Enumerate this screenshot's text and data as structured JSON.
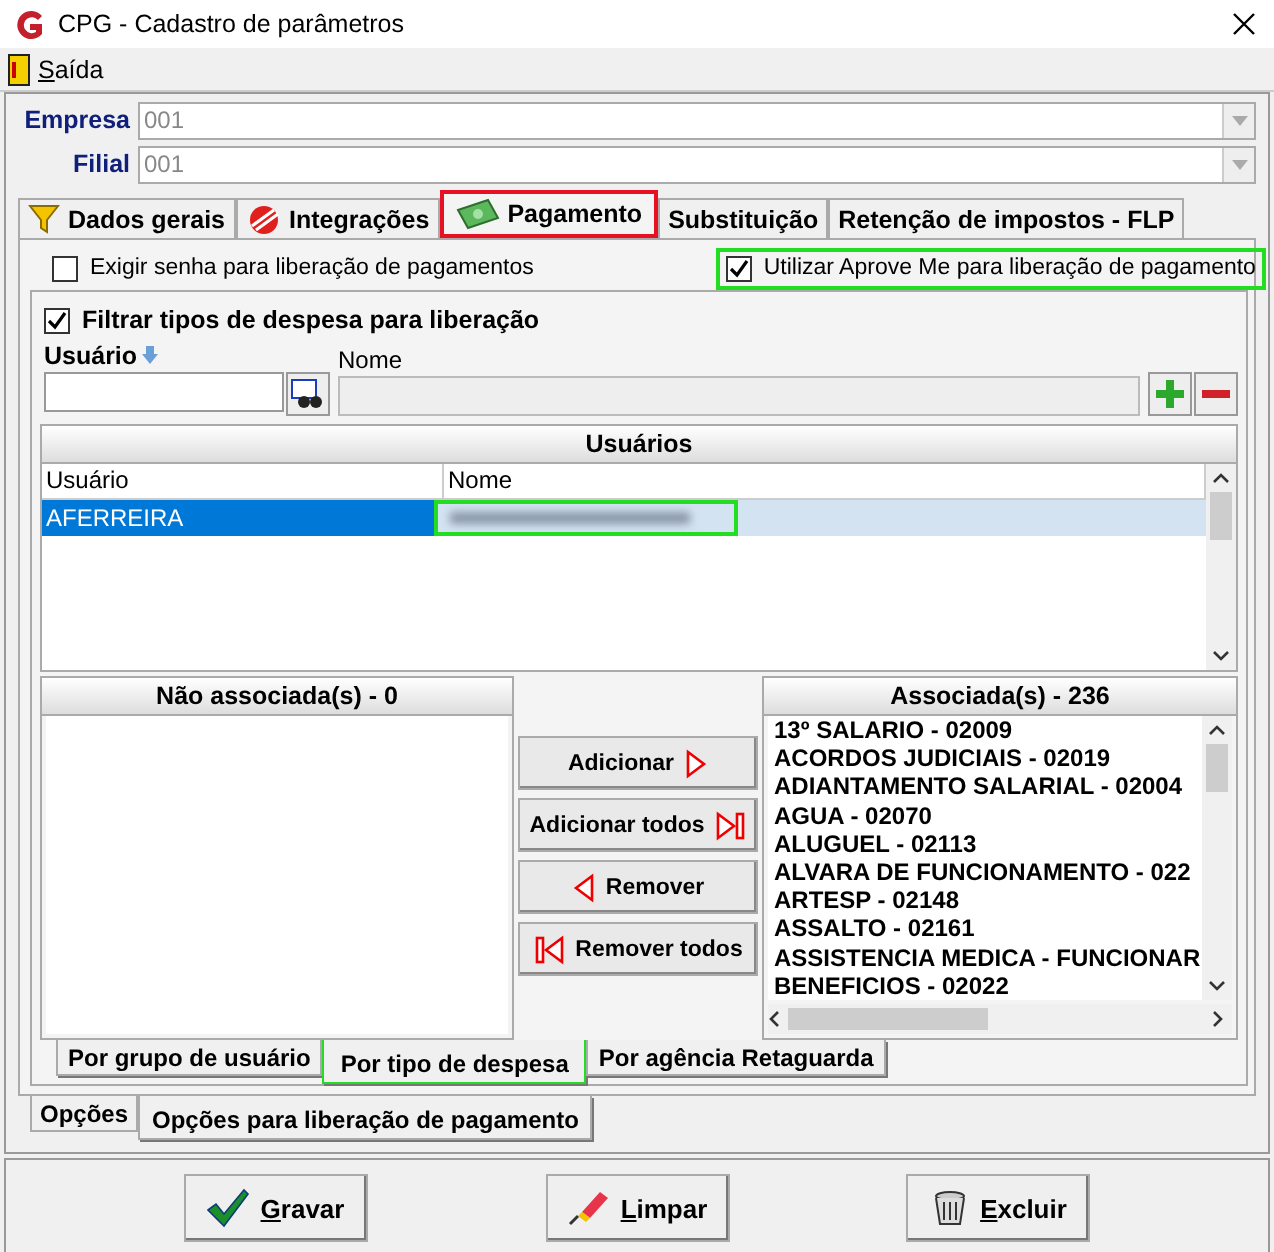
{
  "window": {
    "title": "CPG - Cadastro de parâmetros"
  },
  "menu": [
    {
      "key": "S",
      "rest": "aída"
    }
  ],
  "fields": [
    {
      "label": "Empresa",
      "value": "001",
      "disabled": true
    },
    {
      "label": "Filial",
      "value": "001",
      "disabled": true
    }
  ],
  "tabs": [
    {
      "label": "Dados gerais",
      "selected": false
    },
    {
      "label": "Integrações",
      "selected": false
    },
    {
      "label": "Pagamento",
      "selected": true,
      "color": "#e81123"
    },
    {
      "label": "Substituição",
      "selected": false
    },
    {
      "label": "Retenção de impostos - FLP",
      "selected": false
    }
  ],
  "options": [
    {
      "label": "Exigir senha para liberação de pagamentos",
      "checked": false
    },
    {
      "label": "Utilizar Aprove Me para liberação de pagamento",
      "checked": true,
      "color": "#22dd22"
    }
  ],
  "filter": {
    "label": "Filtrar tipos de despesa para liberação",
    "checked": true
  },
  "user_field": {
    "label": "Usuário"
  },
  "name_field": {
    "label": "Nome"
  },
  "users_grid": {
    "title": "Usuários",
    "columns": [
      "Usuário",
      "Nome"
    ],
    "rows": [
      {
        "usuario": "AFERREIRA",
        "name_blurred": true,
        "selected": true,
        "color": "#22dd22"
      }
    ]
  },
  "unassociated": {
    "title": "Não associada(s) - 0"
  },
  "actions": [
    {
      "label": "Adicionar",
      "kind": "add"
    },
    {
      "label": "Adicionar todos",
      "kind": "add_all"
    },
    {
      "label": "Remover",
      "kind": "remove"
    },
    {
      "label": "Remover todos",
      "kind": "remove_all"
    }
  ],
  "associated": {
    "title": "Associada(s) - 236",
    "items": [
      "13º SALARIO - 02009",
      "ACORDOS JUDICIAIS - 02019",
      "ADIANTAMENTO SALARIAL - 02004",
      "AGUA - 02070",
      "ALUGUEL - 02113",
      "ALVARA DE FUNCIONAMENTO - 022",
      "ARTESP - 02148",
      "ASSALTO - 02161",
      "ASSISTENCIA MEDICA - FUNCIONAR",
      "BENEFICIOS - 02022"
    ]
  },
  "sub_tabs": [
    {
      "label": "Por grupo de usuário",
      "selected": false
    },
    {
      "label": "Por tipo de despesa",
      "selected": true,
      "color": "#22dd22"
    },
    {
      "label": "Por agência Retaguarda",
      "selected": false
    }
  ],
  "bottom_tabs": [
    {
      "label": "Opções",
      "selected": false
    },
    {
      "label": "Opções para liberação de pagamento",
      "selected": true
    }
  ],
  "buttons": [
    {
      "key": "G",
      "rest": "ravar",
      "kind": "save"
    },
    {
      "key": "L",
      "rest": "impar",
      "kind": "clear"
    },
    {
      "key": "E",
      "rest": "xcluir",
      "kind": "delete"
    }
  ]
}
